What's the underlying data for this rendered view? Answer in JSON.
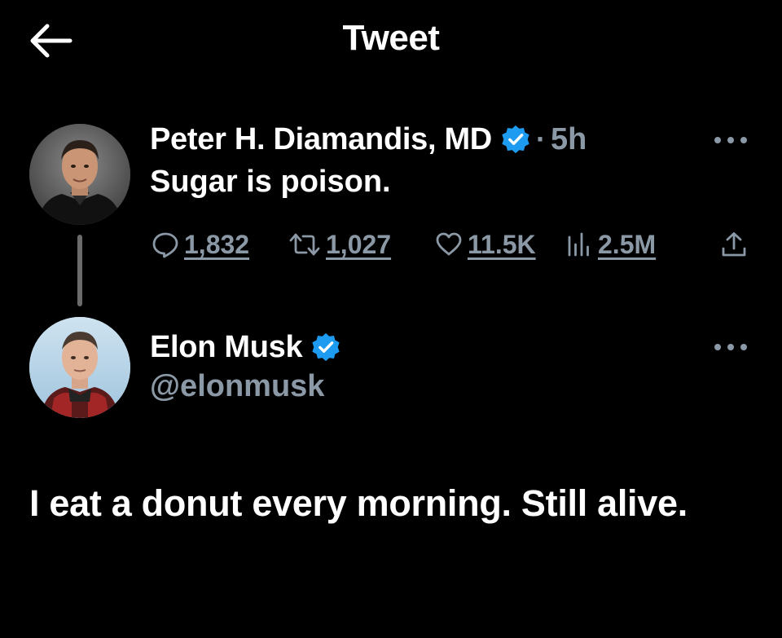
{
  "header": {
    "title": "Tweet",
    "back_icon": "arrow-left-icon"
  },
  "parent_tweet": {
    "display_name": "Peter H. Diamandis, MD",
    "separator": "·",
    "timestamp": "5h",
    "text": "Sugar is poison.",
    "verified": true,
    "stats": {
      "replies": "1,832",
      "retweets": "1,027",
      "likes": "11.5K",
      "views": "2.5M"
    },
    "more_icon": "more-dots-icon"
  },
  "reply_tweet": {
    "display_name": "Elon Musk",
    "handle": "@elonmusk",
    "verified": true,
    "text": "I eat a donut every morning. Still alive.",
    "more_icon": "more-dots-icon"
  },
  "colors": {
    "background": "#000000",
    "primary_text": "#ffffff",
    "secondary_text": "#8b98a5",
    "verified_blue": "#1d9bf0",
    "thread_line": "#6b6b6b"
  }
}
